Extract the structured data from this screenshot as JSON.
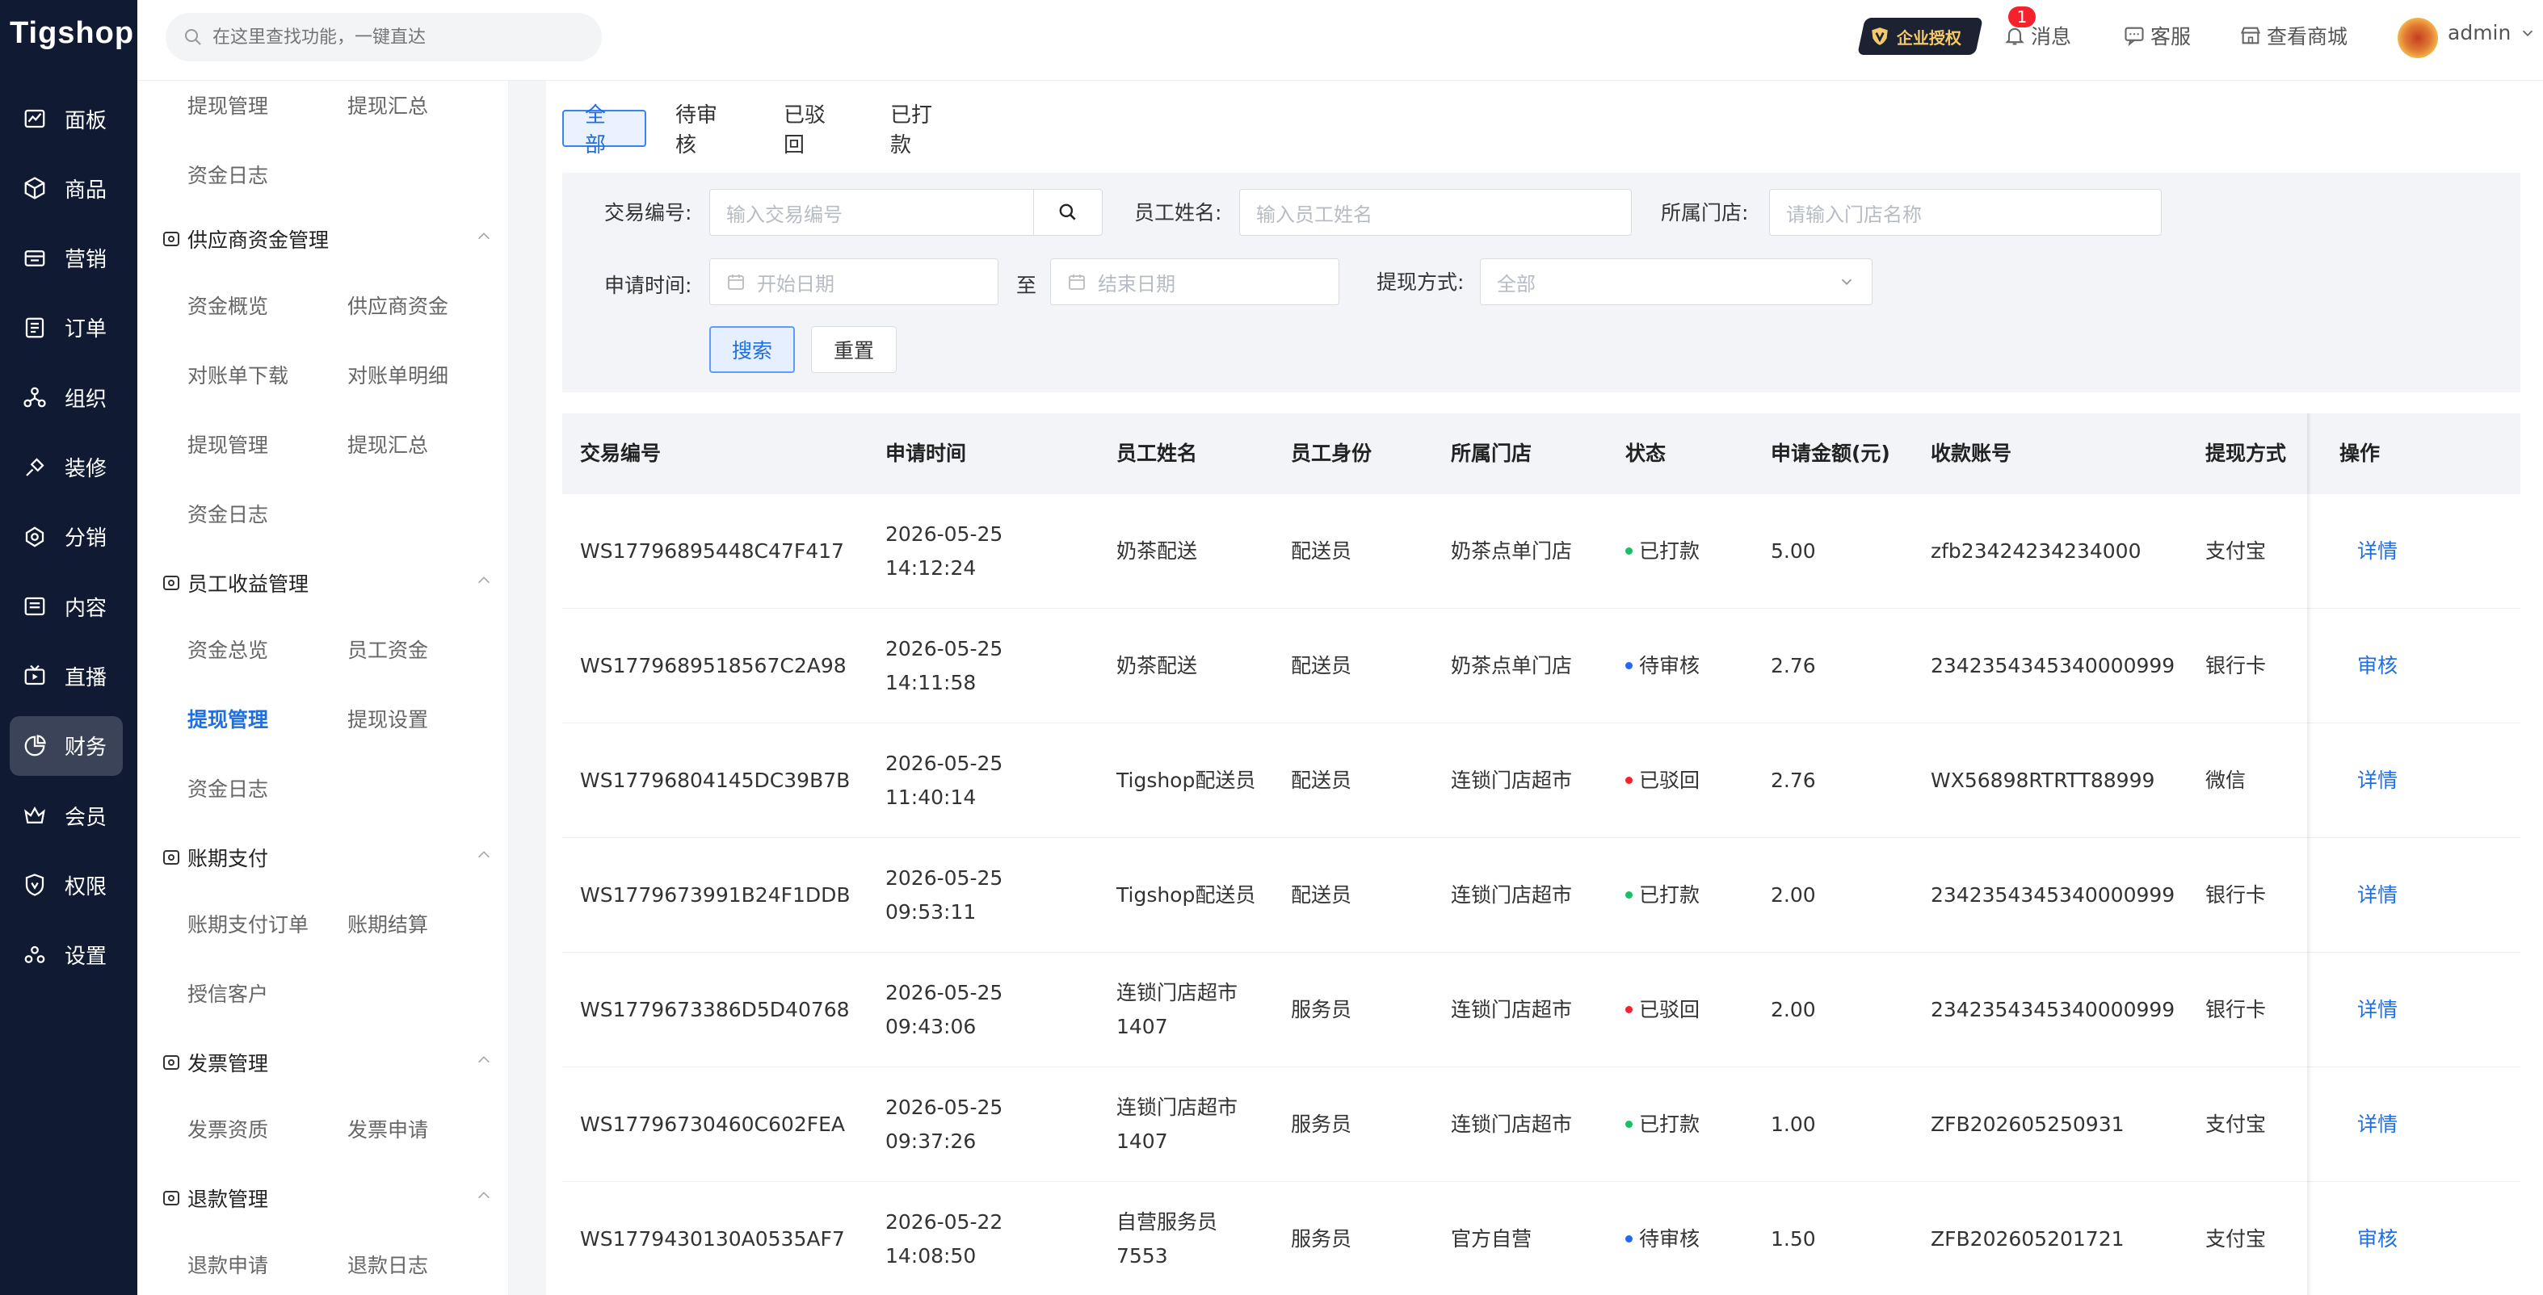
{
  "app": {
    "logo": "Tigshop"
  },
  "nav": {
    "items": [
      {
        "label": "面板",
        "icon": "chart-icon"
      },
      {
        "label": "商品",
        "icon": "box-icon"
      },
      {
        "label": "营销",
        "icon": "ticket-icon"
      },
      {
        "label": "订单",
        "icon": "order-icon"
      },
      {
        "label": "组织",
        "icon": "org-icon"
      },
      {
        "label": "装修",
        "icon": "brush-icon"
      },
      {
        "label": "分销",
        "icon": "share-icon"
      },
      {
        "label": "内容",
        "icon": "article-icon"
      },
      {
        "label": "直播",
        "icon": "live-icon"
      },
      {
        "label": "财务",
        "icon": "pie-icon"
      },
      {
        "label": "会员",
        "icon": "crown-icon"
      },
      {
        "label": "权限",
        "icon": "shield-icon"
      },
      {
        "label": "设置",
        "icon": "settings-icon"
      }
    ],
    "active": "财务"
  },
  "header": {
    "search_placeholder": "在这里查找功能，一键直达",
    "enterprise_badge": "企业授权",
    "message_label": "消息",
    "message_count": "1",
    "service_label": "客服",
    "store_label": "查看商城",
    "user_name": "admin"
  },
  "submenu": {
    "top_links": [
      "提现管理",
      "提现汇总",
      "资金日志"
    ],
    "groups": [
      {
        "title": "供应商资金管理",
        "links": [
          "资金概览",
          "供应商资金",
          "对账单下载",
          "对账单明细",
          "提现管理",
          "提现汇总",
          "资金日志"
        ]
      },
      {
        "title": "员工收益管理",
        "links": [
          "资金总览",
          "员工资金",
          "提现管理",
          "提现设置",
          "资金日志"
        ]
      },
      {
        "title": "账期支付",
        "links": [
          "账期支付订单",
          "账期结算",
          "授信客户"
        ]
      },
      {
        "title": "发票管理",
        "links": [
          "发票资质",
          "发票申请"
        ]
      },
      {
        "title": "退款管理",
        "links": [
          "退款申请",
          "退款日志"
        ]
      }
    ],
    "active_link": "提现管理"
  },
  "tabs": [
    "全部",
    "待审核",
    "已驳回",
    "已打款"
  ],
  "filter": {
    "trade_no_label": "交易编号:",
    "trade_no_placeholder": "输入交易编号",
    "staff_name_label": "员工姓名:",
    "staff_name_placeholder": "输入员工姓名",
    "shop_label": "所属门店:",
    "shop_placeholder": "请输入门店名称",
    "apply_time_label": "申请时间:",
    "start_placeholder": "开始日期",
    "to_label": "至",
    "end_placeholder": "结束日期",
    "method_label": "提现方式:",
    "method_value": "全部",
    "search_button": "搜索",
    "reset_button": "重置"
  },
  "table": {
    "columns": [
      "交易编号",
      "申请时间",
      "员工姓名",
      "员工身份",
      "所属门店",
      "状态",
      "申请金额(元)",
      "收款账号",
      "提现方式",
      "操作"
    ],
    "rows": [
      {
        "id": "WS17796895448C47F417",
        "date": "2026-05-25",
        "time": "14:12:24",
        "name1": "奶茶配送",
        "name2": "",
        "role": "配送员",
        "shop": "奶茶点单门店",
        "status": "已打款",
        "status_color": "#19be6b",
        "amount": "5.00",
        "account": "zfb23424234234000",
        "method": "支付宝",
        "action": "详情"
      },
      {
        "id": "WS1779689518567C2A98",
        "date": "2026-05-25",
        "time": "14:11:58",
        "name1": "奶茶配送",
        "name2": "",
        "role": "配送员",
        "shop": "奶茶点单门店",
        "status": "待审核",
        "status_color": "#2468f2",
        "amount": "2.76",
        "account": "2342354345340000999",
        "method": "银行卡",
        "action": "审核"
      },
      {
        "id": "WS17796804145DC39B7B",
        "date": "2026-05-25",
        "time": "11:40:14",
        "name1": "Tigshop配送员",
        "name2": "",
        "role": "配送员",
        "shop": "连锁门店超市",
        "status": "已驳回",
        "status_color": "#f5222d",
        "amount": "2.76",
        "account": "WX56898RTRTT88999",
        "method": "微信",
        "action": "详情"
      },
      {
        "id": "WS1779673991B24F1DDB",
        "date": "2026-05-25",
        "time": "09:53:11",
        "name1": "Tigshop配送员",
        "name2": "",
        "role": "配送员",
        "shop": "连锁门店超市",
        "status": "已打款",
        "status_color": "#19be6b",
        "amount": "2.00",
        "account": "2342354345340000999",
        "method": "银行卡",
        "action": "详情"
      },
      {
        "id": "WS1779673386D5D40768",
        "date": "2026-05-25",
        "time": "09:43:06",
        "name1": "连锁门店超市",
        "name2": "1407",
        "role": "服务员",
        "shop": "连锁门店超市",
        "status": "已驳回",
        "status_color": "#f5222d",
        "amount": "2.00",
        "account": "2342354345340000999",
        "method": "银行卡",
        "action": "详情"
      },
      {
        "id": "WS17796730460C602FEA",
        "date": "2026-05-25",
        "time": "09:37:26",
        "name1": "连锁门店超市",
        "name2": "1407",
        "role": "服务员",
        "shop": "连锁门店超市",
        "status": "已打款",
        "status_color": "#19be6b",
        "amount": "1.00",
        "account": "ZFB202605250931",
        "method": "支付宝",
        "action": "详情"
      },
      {
        "id": "WS1779430130A0535AF7",
        "date": "2026-05-22",
        "time": "14:08:50",
        "name1": "自营服务员",
        "name2": "7553",
        "role": "服务员",
        "shop": "官方自营",
        "status": "待审核",
        "status_color": "#2468f2",
        "amount": "1.50",
        "account": "ZFB202605201721",
        "method": "支付宝",
        "action": "审核"
      }
    ]
  }
}
